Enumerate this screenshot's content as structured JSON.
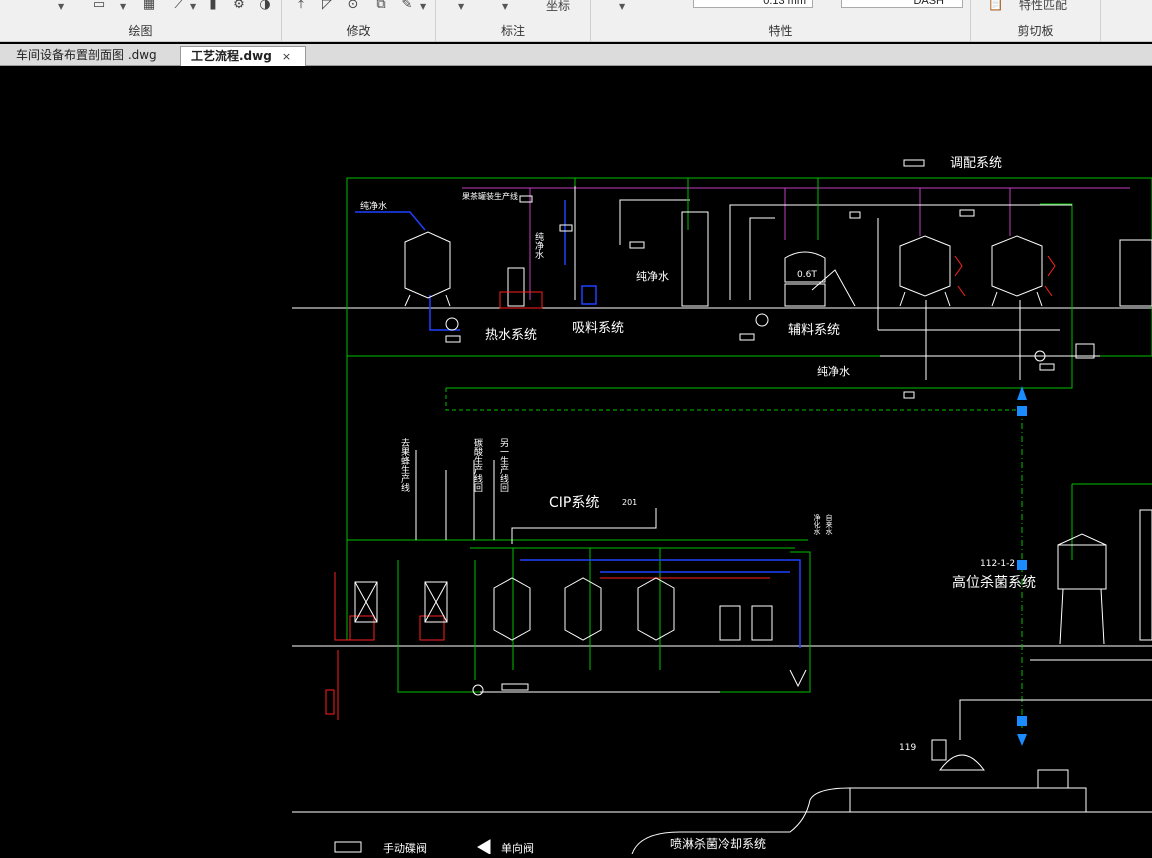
{
  "ribbon": {
    "groups": [
      {
        "label": "绘图"
      },
      {
        "label": "修改"
      },
      {
        "label": "标注"
      },
      {
        "label": "特性"
      },
      {
        "label": "剪切板"
      }
    ],
    "coord_label": "坐标",
    "lineweight_value": "0.13 mm",
    "linetype_value": "DASH",
    "match_properties_label": "特性匹配",
    "icons": [
      "line-icon",
      "rectangle-icon",
      "hatch-icon",
      "move-icon",
      "measure-icon",
      "circle-icon",
      "copy-icon",
      "paste-icon"
    ]
  },
  "tabs": [
    {
      "label": "车间设备布置剖面图 .dwg",
      "active": false
    },
    {
      "label": "工艺流程.dwg",
      "active": true,
      "close": "×"
    }
  ],
  "drawing": {
    "labels": {
      "tiaopei": "调配系统",
      "reshui": "热水系统",
      "xiliao": "吸料系统",
      "fuliao": "辅料系统",
      "chunjingshui_1": "纯净水",
      "chunjingshui_2": "纯净水",
      "chunjingshui_3": "纯净水",
      "chunjingshui_v": "纯净水",
      "guo_line": "果茶罐装生产线",
      "cip": "CIP系统",
      "cip_num": "201",
      "gaowei": "高位杀菌系统",
      "gaowei_num": "112-1-2",
      "tank_06t": "0.6T",
      "num_119": "119",
      "penlin": "喷淋杀菌冷却系统",
      "v_text_1": "去果蜂生产线",
      "v_text_2": "碳酸生产线回",
      "v_text_3": "另一生产线回",
      "v_text_4": "净化水",
      "v_text_5": "自来水"
    },
    "legend": [
      {
        "label": "手动碟阀"
      },
      {
        "label": "单向阀"
      }
    ],
    "colors": {
      "green": "#00c000",
      "white": "#ffffff",
      "magenta": "#c040c0",
      "red": "#ff2020",
      "blue": "#2040ff",
      "cyan_blue": "#1a8cff"
    }
  }
}
